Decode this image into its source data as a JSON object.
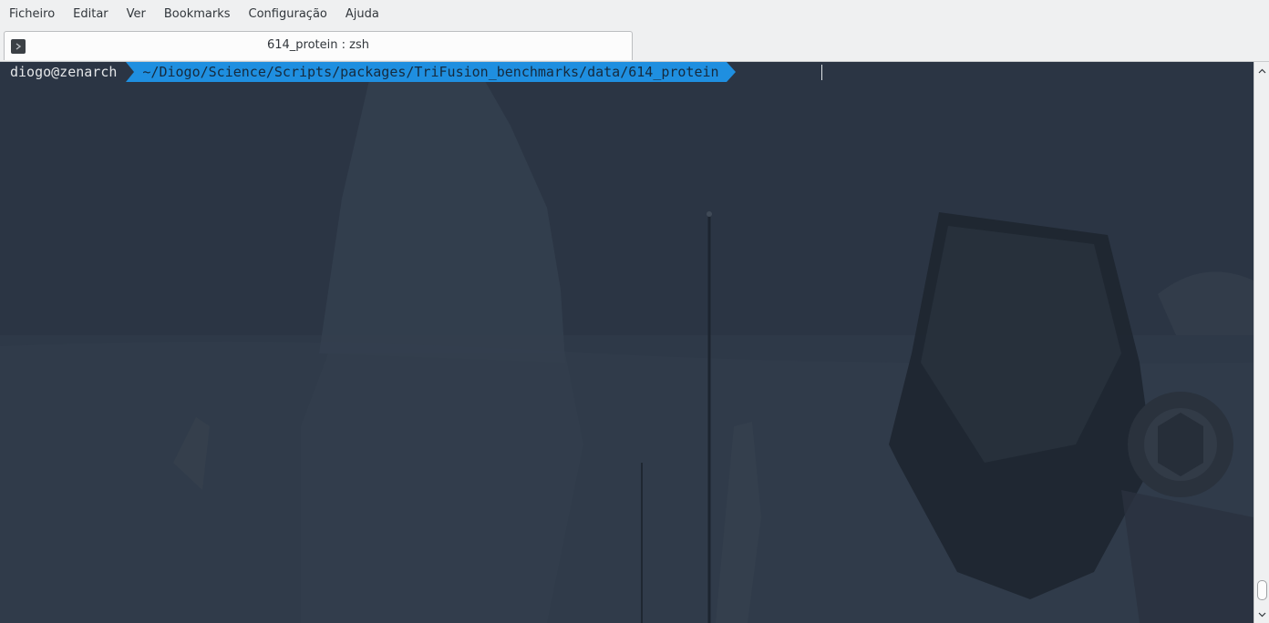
{
  "menubar": {
    "items": [
      "Ficheiro",
      "Editar",
      "Ver",
      "Bookmarks",
      "Configuração",
      "Ajuda"
    ]
  },
  "tabs": [
    {
      "title": "614_protein : zsh",
      "icon": "terminal-icon"
    }
  ],
  "terminal": {
    "prompt_user": "diogo@zenarch",
    "prompt_path": "~/Diogo/Science/Scripts/packages/TriFusion_benchmarks/data/614_protein",
    "colors": {
      "background": "#2b3544",
      "path_segment": "#1f8fe0",
      "path_text": "#162a3d",
      "user_text": "#e4e6e8"
    }
  },
  "scrollbar": {
    "up_icon": "chevron-up-icon",
    "down_icon": "chevron-down-icon"
  }
}
